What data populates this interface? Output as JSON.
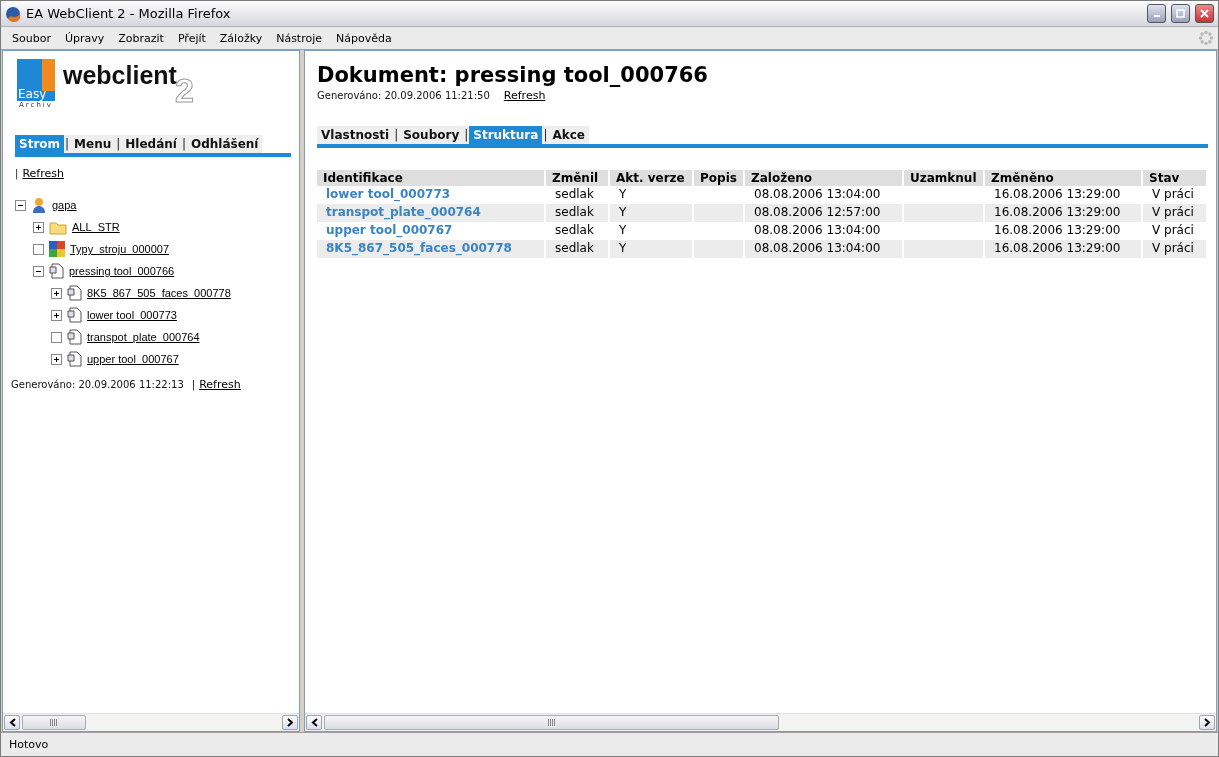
{
  "window": {
    "title": "EA WebClient 2 - Mozilla Firefox"
  },
  "menu": [
    "Soubor",
    "Úpravy",
    "Zobrazit",
    "Přejít",
    "Záložky",
    "Nástroje",
    "Nápověda"
  ],
  "logo": {
    "brand": "webclient",
    "version": "2",
    "mark_top": "Easy",
    "mark_bottom": "Archiv"
  },
  "left_tabs": [
    {
      "label": "Strom",
      "selected": true
    },
    {
      "separator_before": "|",
      "label": "Menu",
      "selected": false
    },
    {
      "separator_before": "|",
      "label": "Hledání",
      "selected": false
    },
    {
      "separator_before": "|",
      "label": "Odhlášení",
      "selected": false
    }
  ],
  "left_refresh": {
    "separator": "|",
    "label": "Refresh"
  },
  "tree": [
    {
      "label": "gapa",
      "kind": "user",
      "expandable": true,
      "expanded": true,
      "children": [
        {
          "label": "ALL_STR",
          "kind": "folder",
          "expandable": true,
          "expanded": false
        },
        {
          "label": "Typy_stroju_000007",
          "kind": "class",
          "expandable": false
        },
        {
          "label": "pressing tool_000766",
          "kind": "document",
          "expandable": true,
          "expanded": true,
          "children": [
            {
              "label": "8K5_867_505_faces_000778",
              "kind": "document",
              "expandable": true,
              "expanded": false
            },
            {
              "label": "lower tool_000773",
              "kind": "document",
              "expandable": true,
              "expanded": false
            },
            {
              "label": "transpot_plate_000764",
              "kind": "document",
              "expandable": false
            },
            {
              "label": "upper tool_000767",
              "kind": "document",
              "expandable": true,
              "expanded": false
            }
          ]
        }
      ]
    }
  ],
  "left_generated": {
    "text": "Generováno: 20.09.2006 11:22:13",
    "separator": "|",
    "refresh": "Refresh"
  },
  "document": {
    "title": "Dokument: pressing tool_000766",
    "generated": "Generováno: 20.09.2006 11:21:50",
    "refresh": "Refresh"
  },
  "right_tabs": [
    {
      "label": "Vlastnosti",
      "selected": false
    },
    {
      "separator_before": "|",
      "label": "Soubory",
      "selected": false
    },
    {
      "separator_before": "|",
      "label": "Struktura",
      "selected": true
    },
    {
      "separator_before": "|",
      "label": "Akce",
      "selected": false
    }
  ],
  "table": {
    "columns": [
      "Identifikace",
      "Změnil",
      "Akt. verze",
      "Popis",
      "Založeno",
      "Uzamknul",
      "Změněno",
      "Stav"
    ],
    "rows": [
      [
        "lower tool_000773",
        "sedlak",
        "Y",
        "",
        "08.08.2006 13:04:00",
        "",
        "16.08.2006 13:29:00",
        "V práci"
      ],
      [
        "transpot_plate_000764",
        "sedlak",
        "Y",
        "",
        "08.08.2006 12:57:00",
        "",
        "16.08.2006 13:29:00",
        "V práci"
      ],
      [
        "upper tool_000767",
        "sedlak",
        "Y",
        "",
        "08.08.2006 13:04:00",
        "",
        "16.08.2006 13:29:00",
        "V práci"
      ],
      [
        "8K5_867_505_faces_000778",
        "sedlak",
        "Y",
        "",
        "08.08.2006 13:04:00",
        "",
        "16.08.2006 13:29:00",
        "V práci"
      ]
    ]
  },
  "status_bar": "Hotovo"
}
